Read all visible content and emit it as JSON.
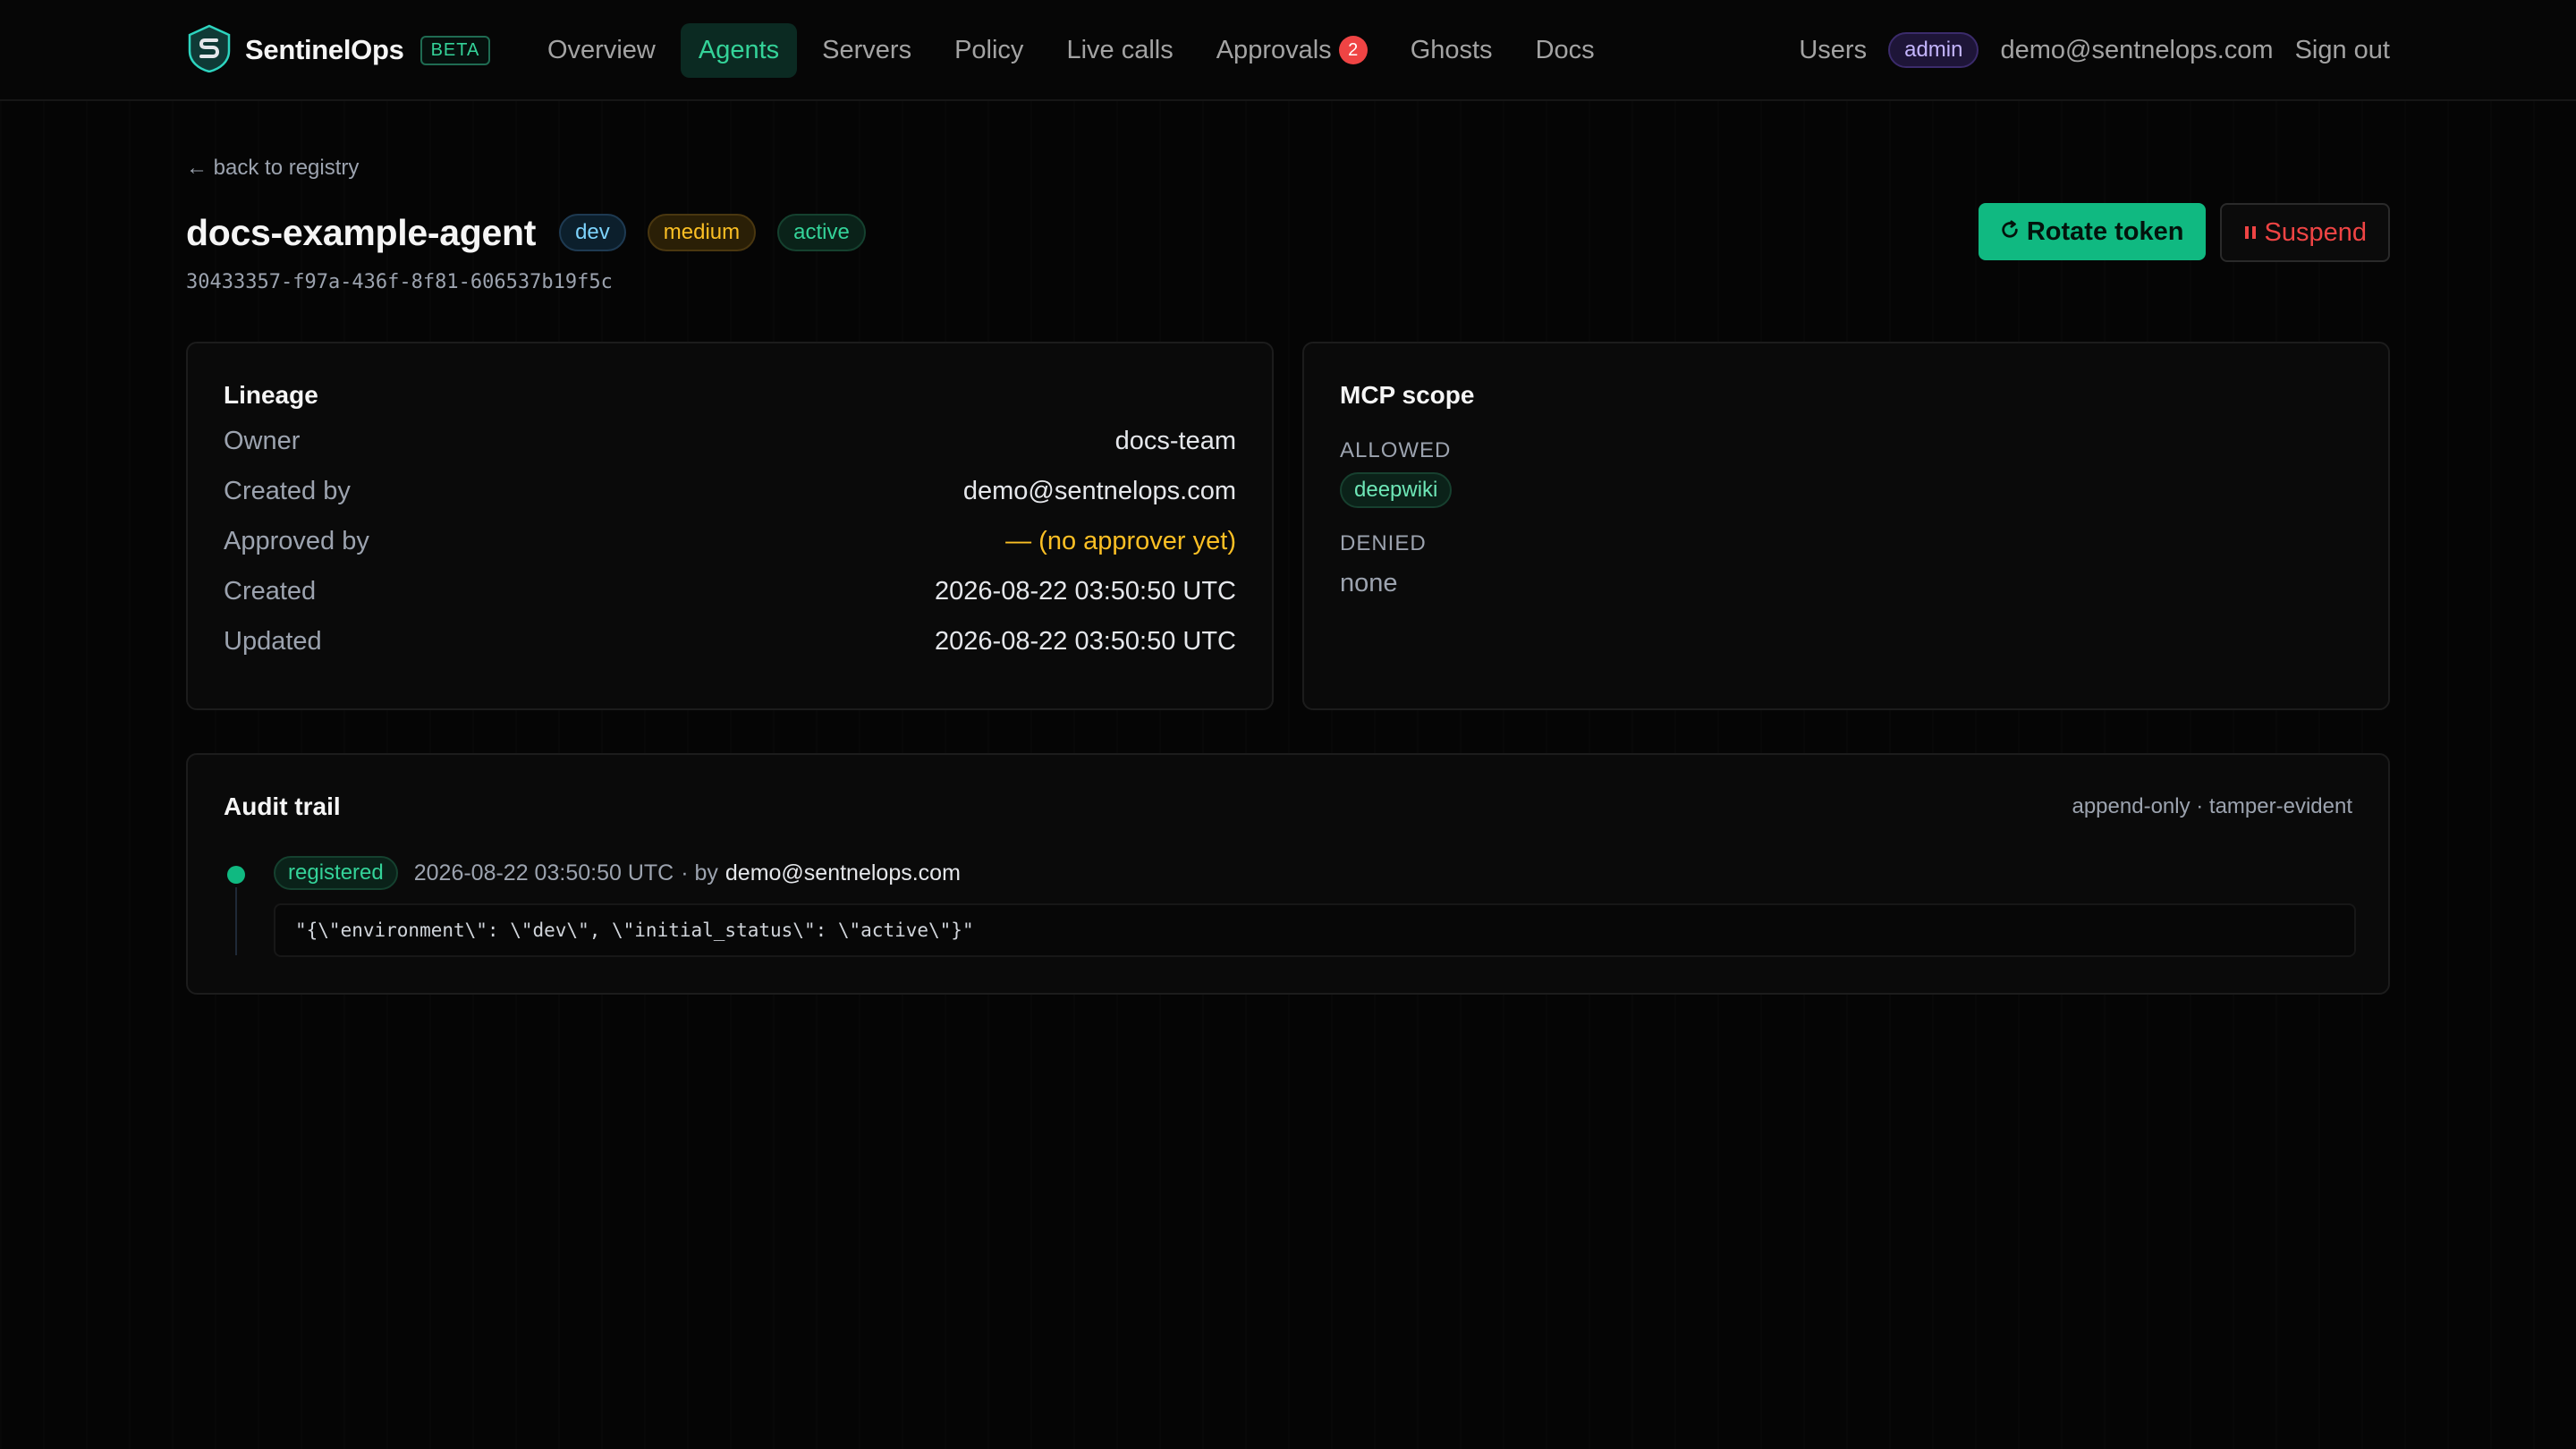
{
  "brand": {
    "name": "SentinelOps",
    "badge": "BETA"
  },
  "nav": {
    "items": [
      {
        "label": "Overview"
      },
      {
        "label": "Agents"
      },
      {
        "label": "Servers"
      },
      {
        "label": "Policy"
      },
      {
        "label": "Live calls"
      },
      {
        "label": "Approvals",
        "count": "2"
      },
      {
        "label": "Ghosts"
      },
      {
        "label": "Docs"
      }
    ],
    "active": "Agents"
  },
  "user": {
    "users_link": "Users",
    "role": "admin",
    "email": "demo@sentnelops.com",
    "sign_out": "Sign out"
  },
  "page": {
    "back_link": "← back to registry",
    "title": "docs-example-agent",
    "tags": {
      "env": "dev",
      "risk": "medium",
      "status": "active"
    },
    "agent_id": "30433357-f97a-436f-8f81-606537b19f5c"
  },
  "actions": {
    "rotate": "Rotate token",
    "suspend": "Suspend"
  },
  "lineage": {
    "title": "Lineage",
    "rows": [
      {
        "key": "Owner",
        "value": "docs-team"
      },
      {
        "key": "Created by",
        "value": "demo@sentnelops.com"
      },
      {
        "key": "Approved by",
        "value": "— (no approver yet)"
      },
      {
        "key": "Created",
        "value": "2026-08-22 03:50:50 UTC"
      },
      {
        "key": "Updated",
        "value": "2026-08-22 03:50:50 UTC"
      }
    ]
  },
  "scope": {
    "title": "MCP scope",
    "allowed_label": "ALLOWED",
    "allowed": [
      "deepwiki"
    ],
    "denied_label": "DENIED",
    "denied_text": "none"
  },
  "audit": {
    "title": "Audit trail",
    "note": "append-only · tamper-evident",
    "events": [
      {
        "type": "registered",
        "time": "2026-08-22 03:50:50 UTC",
        "by_label": "· by",
        "user": "demo@sentnelops.com",
        "payload": "\"{\\\"environment\\\": \\\"dev\\\", \\\"initial_status\\\": \\\"active\\\"}\""
      }
    ]
  },
  "colors": {
    "accent": "#10b981",
    "danger": "#ef4444",
    "warn": "#fbbf24",
    "background": "#050505"
  }
}
